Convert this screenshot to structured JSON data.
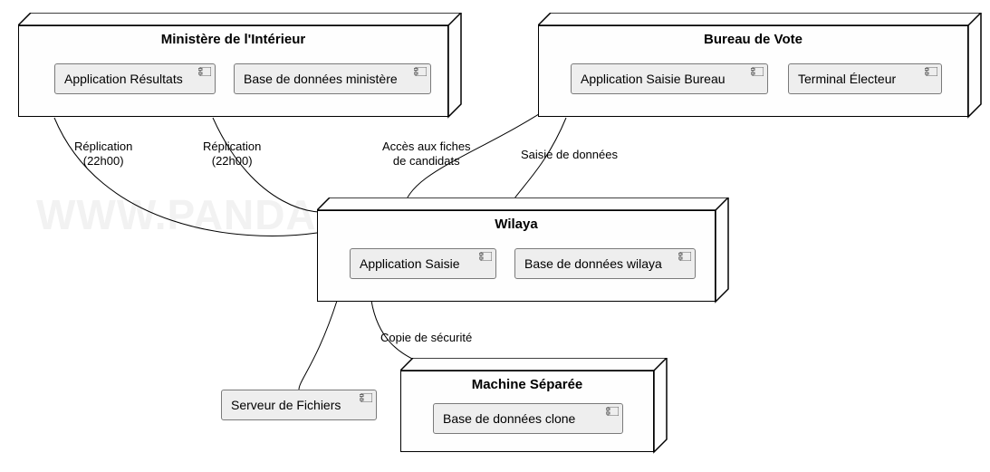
{
  "watermark": "WWW.PANDACODEUR.COM",
  "nodes": {
    "ministere": {
      "title": "Ministère de l'Intérieur",
      "components": {
        "appResultats": "Application Résultats",
        "dbMinistere": "Base de données ministère"
      }
    },
    "bureau": {
      "title": "Bureau de Vote",
      "components": {
        "appSaisieBureau": "Application Saisie Bureau",
        "terminalElecteur": "Terminal Électeur"
      }
    },
    "wilaya": {
      "title": "Wilaya",
      "components": {
        "appSaisie": "Application Saisie",
        "dbWilaya": "Base de données wilaya"
      }
    },
    "machineSeparee": {
      "title": "Machine Séparée",
      "components": {
        "dbClone": "Base de données clone"
      }
    },
    "serveurFichiers": {
      "label": "Serveur de Fichiers"
    }
  },
  "edges": {
    "replication1": "Réplication\n(22h00)",
    "replication2": "Réplication\n(22h00)",
    "accesFiches": "Accès aux fiches\nde candidats",
    "saisieDonnees": "Saisie de données",
    "copieSecurite": "Copie de sécurité"
  }
}
